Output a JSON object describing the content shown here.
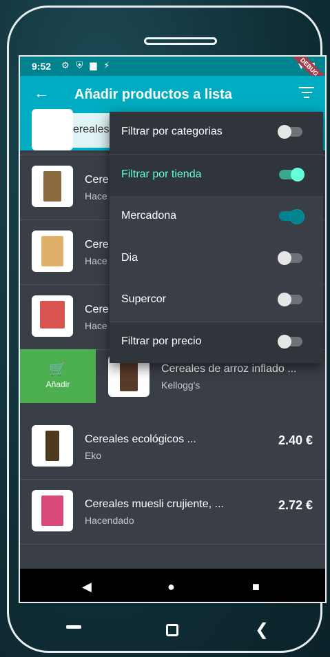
{
  "status": {
    "time": "9:52",
    "debug_label": "DEBUG"
  },
  "appbar": {
    "title": "Añadir productos a lista"
  },
  "search": {
    "value": "cereales"
  },
  "filter_menu": [
    {
      "label": "Filtrar por categorias",
      "on": false
    },
    {
      "label": "Filtrar por tienda",
      "on": true
    },
    {
      "label": "Mercadona",
      "on": true
    },
    {
      "label": "Dia",
      "on": false
    },
    {
      "label": "Supercor",
      "on": false
    },
    {
      "label": "Filtrar por precio",
      "on": false
    }
  ],
  "products": [
    {
      "name": "Cere",
      "brand": "Hace"
    },
    {
      "name": "Cere",
      "brand": "Hace"
    },
    {
      "name": "Cere",
      "brand": "Hace"
    },
    {
      "name": "Cereales de arroz inflado ...",
      "brand": "Kellogg's"
    },
    {
      "name": "Cereales ecológicos ...",
      "brand": "Eko",
      "price": "2.40 €"
    },
    {
      "name": "Cereales muesli crujiente, ...",
      "brand": "Hacendado",
      "price": "2.72 €"
    }
  ],
  "swipe_action": {
    "label": "Añadir"
  },
  "icons": {
    "back": "arrow-back-icon",
    "filter": "filter-icon",
    "search": "search-icon",
    "cart": "add-cart-icon"
  },
  "colors": {
    "appbar": "#00acc1",
    "statusbar": "#00838f",
    "accent": "#64ffda",
    "swipe": "#4caf50"
  }
}
